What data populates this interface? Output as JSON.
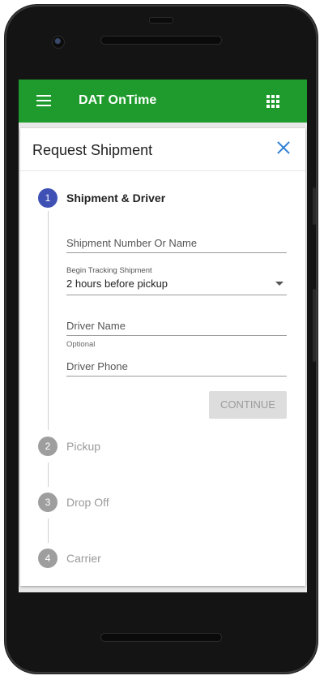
{
  "appbar": {
    "title": "DAT OnTime",
    "menu_icon": "hamburger-menu-icon",
    "apps_icon": "grid-apps-icon",
    "color": "#1e9b2c"
  },
  "dialog": {
    "title": "Request Shipment",
    "close_icon": "close-icon",
    "close_color": "#2f7fd6"
  },
  "stepper": {
    "active_color": "#3f51b5",
    "inactive_color": "#9e9e9e",
    "steps": [
      {
        "number": "1",
        "label": "Shipment & Driver"
      },
      {
        "number": "2",
        "label": "Pickup"
      },
      {
        "number": "3",
        "label": "Drop Off"
      },
      {
        "number": "4",
        "label": "Carrier"
      }
    ]
  },
  "form": {
    "shipment_placeholder": "Shipment Number Or Name",
    "tracking_label": "Begin Tracking Shipment",
    "tracking_value": "2 hours before pickup",
    "driver_name_placeholder": "Driver Name",
    "driver_name_hint": "Optional",
    "driver_phone_placeholder": "Driver Phone",
    "continue_label": "CONTINUE"
  }
}
